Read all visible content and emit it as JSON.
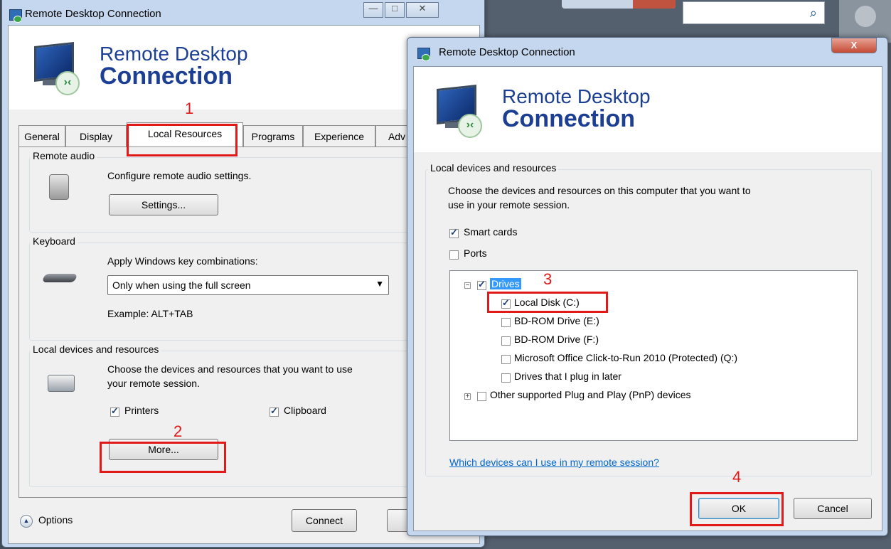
{
  "back_window": {
    "title": "Remote Desktop Connection",
    "banner_line1": "Remote Desktop",
    "banner_line2": "Connection",
    "tabs": [
      "General",
      "Display",
      "Local Resources",
      "Programs",
      "Experience",
      "Adv"
    ],
    "remote_audio": {
      "label": "Remote audio",
      "description": "Configure remote audio settings.",
      "button": "Settings..."
    },
    "keyboard": {
      "label": "Keyboard",
      "description": "Apply Windows key combinations:",
      "selected": "Only when using the full screen",
      "example": "Example: ALT+TAB"
    },
    "local_devices": {
      "label": "Local devices and resources",
      "description_line1": "Choose the devices and resources that you want to use",
      "description_line2": "your remote session.",
      "printers": "Printers",
      "clipboard": "Clipboard",
      "more_button": "More..."
    },
    "options": "Options",
    "connect": "Connect"
  },
  "front_window": {
    "title": "Remote Desktop Connection",
    "close": "X",
    "banner_line1": "Remote Desktop",
    "banner_line2": "Connection",
    "group_label": "Local devices and resources",
    "description_line1": "Choose the devices and resources on this computer that you want to",
    "description_line2": "use in your remote session.",
    "smart_cards": "Smart cards",
    "ports": "Ports",
    "tree": {
      "drives": "Drives",
      "items": [
        "Local Disk (C:)",
        "BD-ROM Drive (E:)",
        "BD-ROM Drive (F:)",
        "Microsoft Office Click-to-Run 2010 (Protected) (Q:)",
        "Drives that I plug in later"
      ],
      "other": "Other supported Plug and Play (PnP) devices"
    },
    "help_link": "Which devices can I use in my remote session?",
    "ok": "OK",
    "cancel": "Cancel"
  },
  "annotations": {
    "n1": "1",
    "n2": "2",
    "n3": "3",
    "n4": "4"
  },
  "colors": {
    "annotation_red": "#e11919",
    "banner_text": "#1c3f94",
    "link": "#0066cc"
  }
}
